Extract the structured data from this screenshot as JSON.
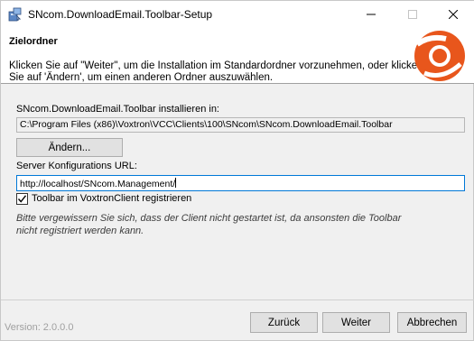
{
  "window": {
    "title": "SNcom.DownloadEmail.Toolbar-Setup",
    "icon": "setup-icon",
    "minimize_glyph": "—",
    "maximize_glyph": "☐",
    "close_glyph": "✕"
  },
  "header": {
    "title": "Zielordner",
    "description": "Klicken Sie auf \"Weiter\", um die Installation im Standardordner vorzunehmen, oder klicken Sie auf 'Ändern', um einen anderen Ordner auszuwählen.",
    "logo": "voxtron-logo"
  },
  "install": {
    "label": "SNcom.DownloadEmail.Toolbar installieren in:",
    "path": "C:\\Program Files (x86)\\Voxtron\\VCC\\Clients\\100\\SNcom\\SNcom.DownloadEmail.Toolbar",
    "change_button": "Ändern..."
  },
  "server": {
    "label": "Server Konfigurations URL:",
    "value": "http://localhost/SNcom.Management/"
  },
  "register": {
    "label": "Toolbar im VoxtronClient registrieren",
    "checked": true
  },
  "note": "Bitte vergewissern Sie sich, dass der Client nicht gestartet ist, da ansonsten die Toolbar nicht registriert werden kann.",
  "footer": {
    "version": "Version: 2.0.0.0",
    "back_button": "Zurück",
    "next_button": "Weiter",
    "cancel_button": "Abbrechen"
  },
  "colors": {
    "accent": "#0078d7",
    "logo_orange": "#e8561c"
  }
}
